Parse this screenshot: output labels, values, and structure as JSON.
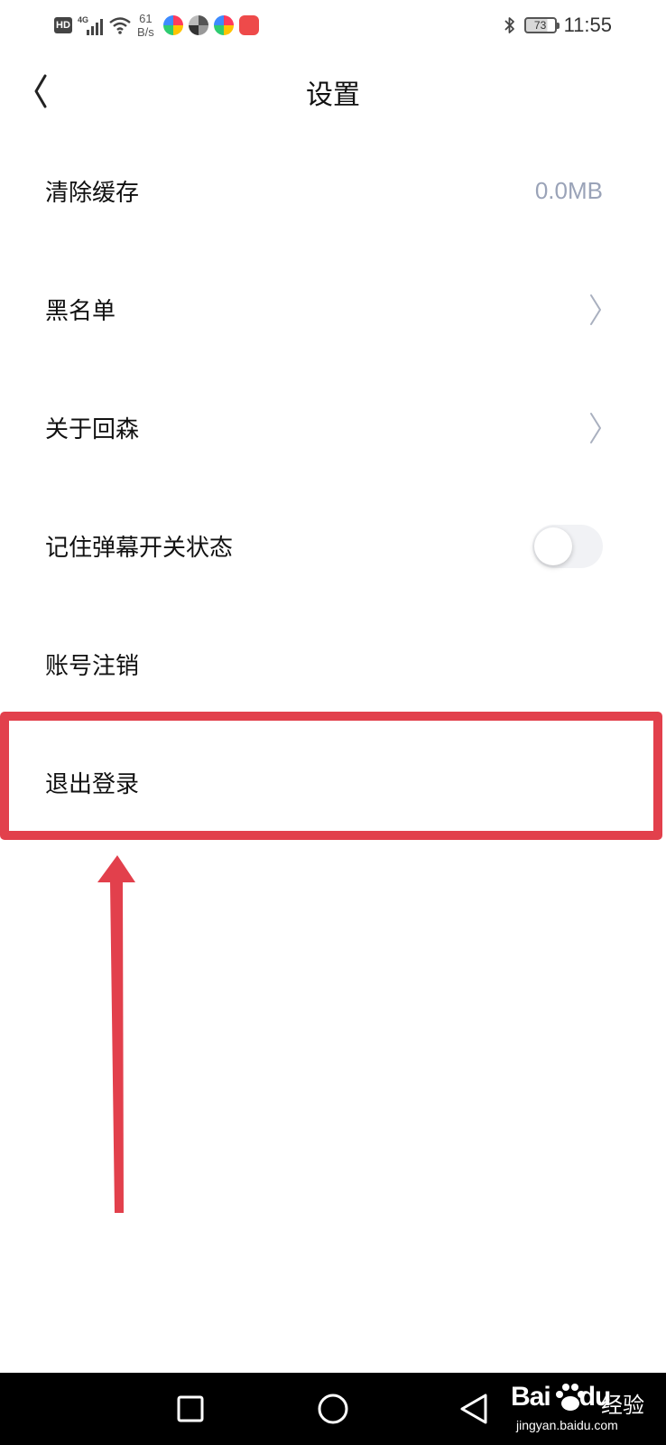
{
  "status_bar": {
    "hd_badge": "HD",
    "network_type": "4G",
    "net_speed_value": "61",
    "net_speed_unit": "B/s",
    "app_icons": [
      "app-notification-icon-1",
      "app-notification-icon-2",
      "app-notification-icon-3",
      "huawei-app-icon"
    ],
    "battery_level": "73",
    "time": "11:55"
  },
  "header": {
    "back_icon": "chevron-left-icon",
    "title": "设置"
  },
  "settings": {
    "clear_cache": {
      "label": "清除缓存",
      "value": "0.0MB"
    },
    "blacklist": {
      "label": "黑名单",
      "icon": "chevron-right-icon"
    },
    "about": {
      "label": "关于回森",
      "icon": "chevron-right-icon"
    },
    "remember_danmaku": {
      "label": "记住弹幕开关状态",
      "enabled": false
    },
    "account_cancel": {
      "label": "账号注销"
    },
    "logout": {
      "label": "退出登录"
    }
  },
  "annotation": {
    "color": "#e2404c",
    "highlight_target": "logout",
    "arrow_direction": "up"
  },
  "nav_bar": {
    "buttons": [
      "recent-apps-square-icon",
      "home-circle-icon",
      "back-triangle-icon"
    ]
  },
  "watermark": {
    "brand": "Bai",
    "brand_suffix": "du",
    "text": "经验",
    "url": "jingyan.baidu.com"
  }
}
